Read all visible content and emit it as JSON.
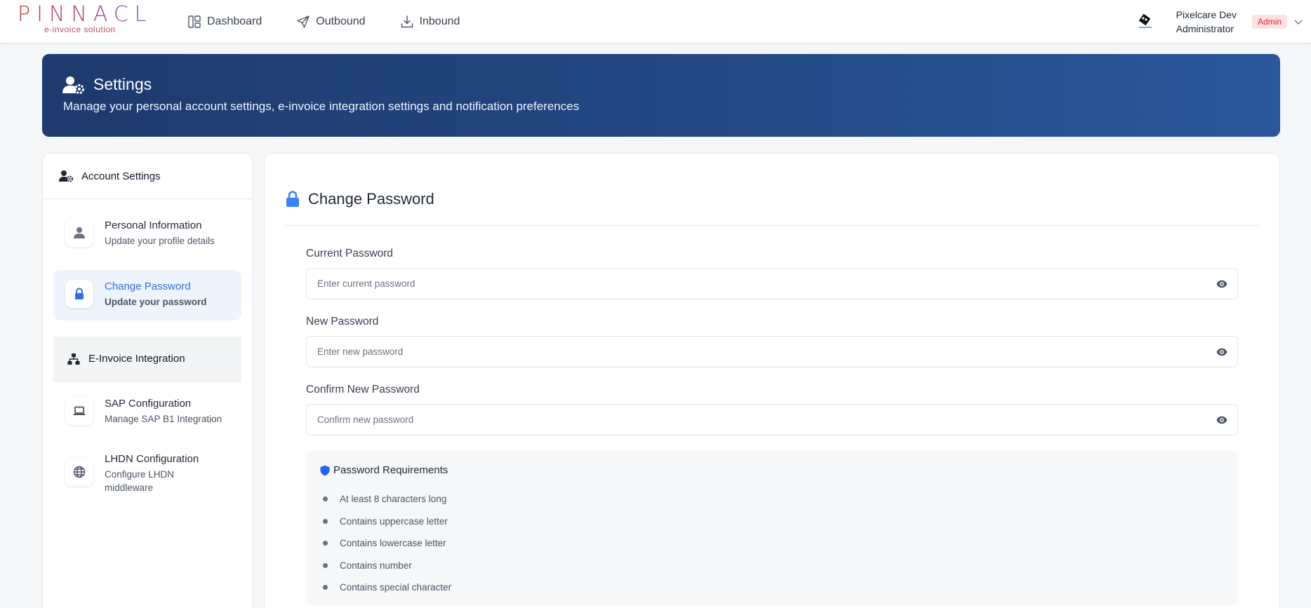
{
  "app": {
    "logo_text": "PINNACLE",
    "logo_sub": "e-invoice solution"
  },
  "nav": {
    "items": [
      {
        "label": "Dashboard",
        "icon": "dashboard-icon"
      },
      {
        "label": "Outbound",
        "icon": "send-icon"
      },
      {
        "label": "Inbound",
        "icon": "download-icon"
      }
    ]
  },
  "user": {
    "name": "Pixelcare Dev",
    "title": "Administrator",
    "role_badge": "Admin"
  },
  "banner": {
    "title": "Settings",
    "description": "Manage your personal account settings, e-invoice integration settings and notification preferences"
  },
  "sidebar": {
    "header": "Account Settings",
    "items": [
      {
        "title": "Personal Information",
        "subtitle": "Update your profile details",
        "icon": "user-icon"
      },
      {
        "title": "Change Password",
        "subtitle": "Update your password",
        "icon": "lock-icon",
        "active": true
      }
    ],
    "section_header": "E-Invoice Integration",
    "integration_items": [
      {
        "title": "SAP Configuration",
        "subtitle": "Manage SAP B1 Integration",
        "icon": "laptop-icon"
      },
      {
        "title": "LHDN Configuration",
        "subtitle": "Configure LHDN middleware",
        "icon": "globe-icon"
      }
    ]
  },
  "main": {
    "title": "Change Password",
    "fields": [
      {
        "label": "Current Password",
        "placeholder": "Enter current password",
        "value": ""
      },
      {
        "label": "New Password",
        "placeholder": "Enter new password",
        "value": ""
      },
      {
        "label": "Confirm New Password",
        "placeholder": "Confirm new password",
        "value": ""
      }
    ],
    "requirements": {
      "title": "Password Requirements",
      "items": [
        "At least 8 characters long",
        "Contains uppercase letter",
        "Contains lowercase letter",
        "Contains number",
        "Contains special character"
      ]
    }
  },
  "colors": {
    "accent_blue": "#2f6fdb",
    "banner_start": "#1e3a6e",
    "banner_end": "#2b579c",
    "badge_bg": "#fde2e2",
    "badge_text": "#dc2626"
  }
}
